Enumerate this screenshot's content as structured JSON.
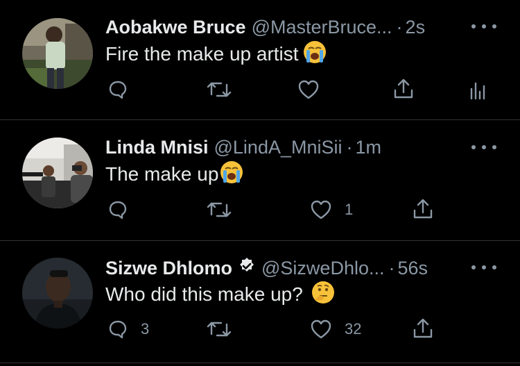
{
  "tweets": [
    {
      "name": "Aobakwe Bruce",
      "handle": "@MasterBruce...",
      "time": "2s",
      "text": "Fire the make up artist",
      "emoji": "loudly-crying-face",
      "verified": false,
      "reply_count": "",
      "retweet_count": "",
      "like_count": ""
    },
    {
      "name": "Linda Mnisi",
      "handle": "@LindA_MniSii",
      "time": "1m",
      "text": "The make up",
      "emoji": "loudly-crying-face",
      "verified": false,
      "reply_count": "",
      "retweet_count": "",
      "like_count": "1"
    },
    {
      "name": "Sizwe Dhlomo",
      "handle": "@SizweDhlo...",
      "time": "56s",
      "text": "Who did this make up?",
      "emoji": "thinking-face",
      "verified": true,
      "reply_count": "3",
      "retweet_count": "",
      "like_count": "32"
    }
  ],
  "separator": "·",
  "colors": {
    "background": "#000000",
    "text": "#e7e9ea",
    "muted": "#8b98a5",
    "divider": "#2f3336"
  }
}
